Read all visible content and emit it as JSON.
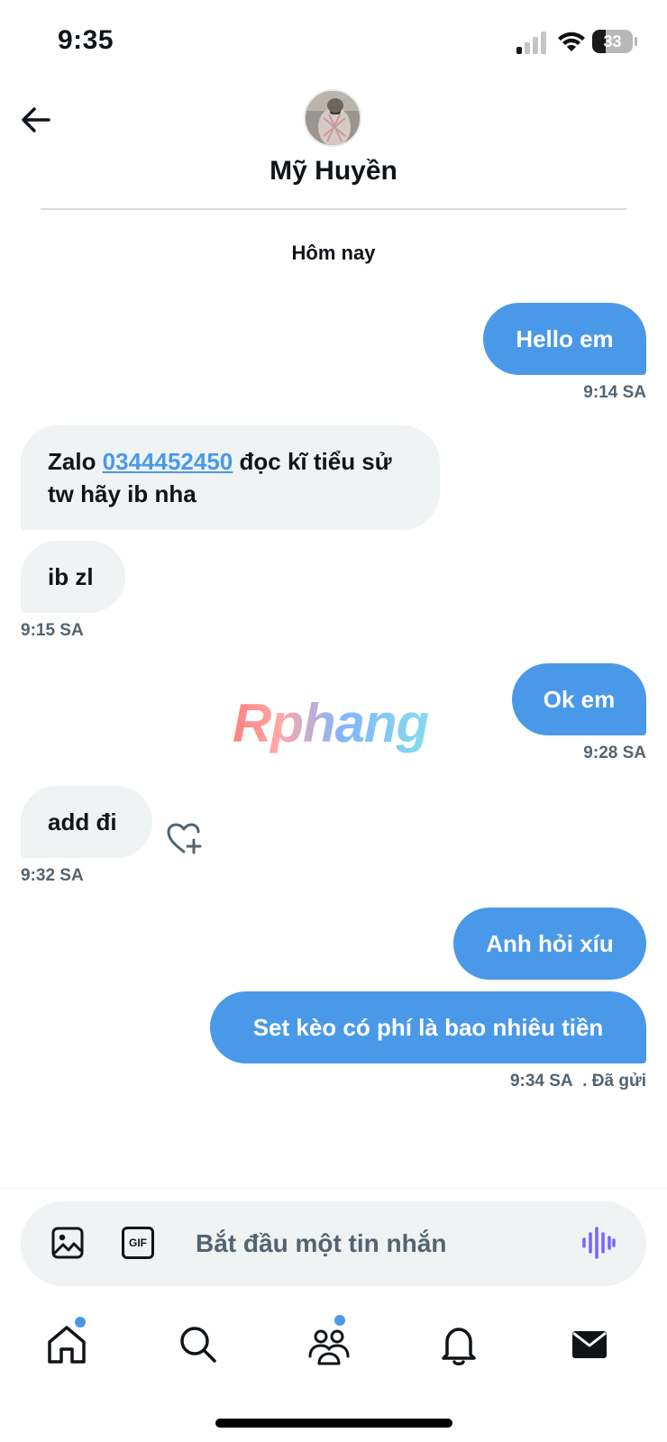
{
  "status_bar": {
    "time": "9:35",
    "battery": "33",
    "battery_level": 0.33
  },
  "header": {
    "contact_name": "Mỹ Huyền"
  },
  "conversation": {
    "day_label": "Hôm nay",
    "msg1": {
      "text": "Hello em",
      "time": "9:14 SA"
    },
    "msg2": {
      "prefix": "Zalo ",
      "phone": "0344452450",
      "suffix": " đọc kĩ tiểu sử tw hãy ib nha"
    },
    "msg3": {
      "text": "ib zl",
      "time": "9:15 SA"
    },
    "msg4": {
      "text": "Ok em",
      "time": "9:28 SA"
    },
    "msg5": {
      "text": "add đi",
      "time": "9:32 SA"
    },
    "msg6": {
      "text": "Anh hỏi xíu"
    },
    "msg7": {
      "text": "Set kèo có phí là bao nhiêu tiền",
      "time": "9:34 SA",
      "status": ". Đã gửi"
    }
  },
  "watermark": {
    "text": "Rphang"
  },
  "composer": {
    "placeholder": "Bắt đầu một tin nhắn",
    "gif_label": "GIF"
  },
  "tabbar": {
    "items": [
      {
        "icon": "home-icon",
        "has_badge": true
      },
      {
        "icon": "search-icon",
        "has_badge": false
      },
      {
        "icon": "communities-icon",
        "has_badge": true
      },
      {
        "icon": "notifications-icon",
        "has_badge": false
      },
      {
        "icon": "messages-icon",
        "has_badge": false,
        "active": true
      }
    ]
  },
  "colors": {
    "accent": "#4a99e9",
    "incoming_bubble": "#eff3f4",
    "text": "#0f1419",
    "muted": "#536471",
    "voice_icon": "#7b61ff"
  }
}
